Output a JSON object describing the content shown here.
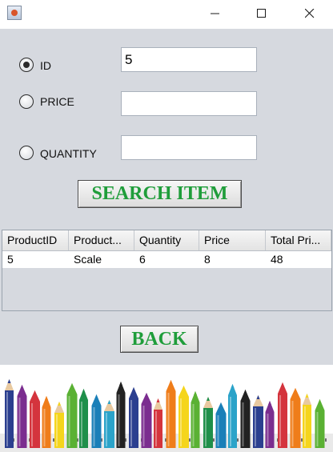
{
  "window": {
    "controls": {
      "minimize_icon": "minimize-icon",
      "maximize_icon": "maximize-icon",
      "close_icon": "close-icon"
    }
  },
  "search": {
    "options": [
      {
        "label": "ID",
        "selected": true
      },
      {
        "label": "PRICE",
        "selected": false
      },
      {
        "label": "QUANTITY",
        "selected": false
      }
    ],
    "id_value": "5",
    "price_value": "",
    "quantity_value": "",
    "button_label": "SEARCH ITEM",
    "button_color": "#1f9d3a"
  },
  "results": {
    "columns": [
      "ProductID",
      "Product...",
      "Quantity",
      "Price",
      "Total Pri..."
    ],
    "rows": [
      [
        "5",
        "Scale",
        "6",
        "8",
        "48"
      ]
    ]
  },
  "back": {
    "label": "BACK"
  },
  "banner": {
    "image": "colored-pencils-and-markers",
    "colors": [
      "#2b3f8f",
      "#7b2d8f",
      "#d4343d",
      "#ef7d1a",
      "#f5d51c",
      "#5ab133",
      "#1f8f4a",
      "#1a7fb8",
      "#2ba3c9",
      "#222222"
    ]
  }
}
